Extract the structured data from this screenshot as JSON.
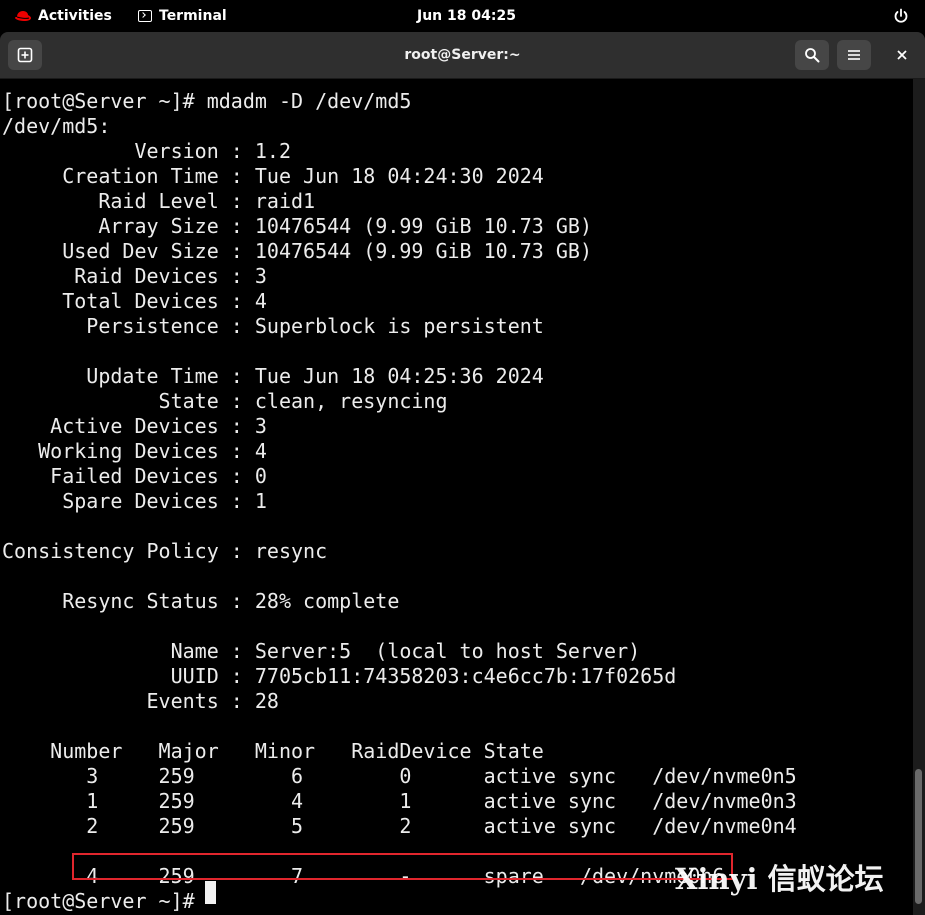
{
  "topbar": {
    "activities": "Activities",
    "app_name": "Terminal",
    "clock": "Jun 18  04:25"
  },
  "window": {
    "title": "root@Server:~"
  },
  "terminal": {
    "lines": [
      "[root@Server ~]# mdadm -D /dev/md5",
      "/dev/md5:",
      "           Version : 1.2",
      "     Creation Time : Tue Jun 18 04:24:30 2024",
      "        Raid Level : raid1",
      "        Array Size : 10476544 (9.99 GiB 10.73 GB)",
      "     Used Dev Size : 10476544 (9.99 GiB 10.73 GB)",
      "      Raid Devices : 3",
      "     Total Devices : 4",
      "       Persistence : Superblock is persistent",
      "",
      "       Update Time : Tue Jun 18 04:25:36 2024",
      "             State : clean, resyncing",
      "    Active Devices : 3",
      "   Working Devices : 4",
      "    Failed Devices : 0",
      "     Spare Devices : 1",
      "",
      "Consistency Policy : resync",
      "",
      "     Resync Status : 28% complete",
      "",
      "              Name : Server:5  (local to host Server)",
      "              UUID : 7705cb11:74358203:c4e6cc7b:17f0265d",
      "            Events : 28",
      "",
      "    Number   Major   Minor   RaidDevice State",
      "       3     259        6        0      active sync   /dev/nvme0n5",
      "       1     259        4        1      active sync   /dev/nvme0n3",
      "       2     259        5        2      active sync   /dev/nvme0n4",
      "",
      "       4     259        7        -      spare   /dev/nvme0n6",
      "[root@Server ~]# "
    ]
  },
  "watermark": {
    "text": "Xinyi 信蚁论坛"
  },
  "colors": {
    "terminal_bg": "#000000",
    "terminal_fg": "#ececec",
    "titlebar_bg": "#2f2f2f",
    "highlight_box": "#e0262d",
    "redhat_red": "#ee0000"
  },
  "icons": {
    "activities": "redhat-logo-icon",
    "app": "terminal-icon",
    "power": "power-icon",
    "new_tab": "new-tab-icon",
    "search": "search-icon",
    "menu": "hamburger-menu-icon",
    "close": "close-icon"
  }
}
